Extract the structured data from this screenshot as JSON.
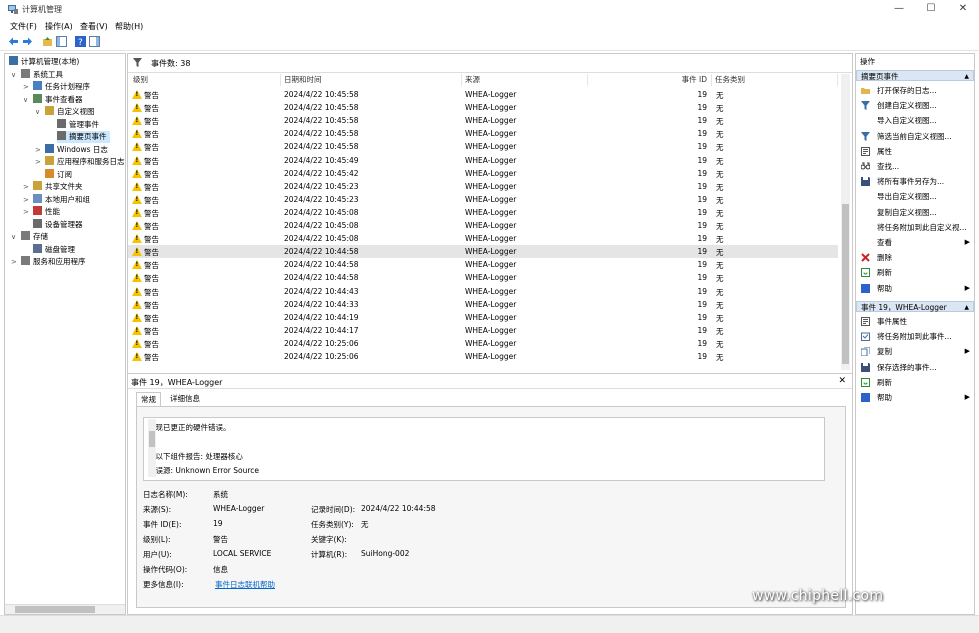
{
  "window": {
    "title": "计算机管理",
    "minimize": "—",
    "maximize": "☐",
    "close": "✕"
  },
  "menu": [
    "文件(F)",
    "操作(A)",
    "查看(V)",
    "帮助(H)"
  ],
  "tree": {
    "items": [
      {
        "label": "计算机管理(本地)",
        "indent": 0,
        "expander": ""
      },
      {
        "label": "系统工具",
        "indent": 1,
        "expander": "∨"
      },
      {
        "label": "任务计划程序",
        "indent": 2,
        "expander": ">"
      },
      {
        "label": "事件查看器",
        "indent": 2,
        "expander": "∨"
      },
      {
        "label": "自定义视图",
        "indent": 3,
        "expander": "∨"
      },
      {
        "label": "管理事件",
        "indent": 4,
        "expander": ""
      },
      {
        "label": "摘要页事件",
        "indent": 4,
        "expander": "",
        "selected": true
      },
      {
        "label": "Windows 日志",
        "indent": 3,
        "expander": ">"
      },
      {
        "label": "应用程序和服务日志",
        "indent": 3,
        "expander": ">"
      },
      {
        "label": "订阅",
        "indent": 3,
        "expander": ""
      },
      {
        "label": "共享文件夹",
        "indent": 2,
        "expander": ">"
      },
      {
        "label": "本地用户和组",
        "indent": 2,
        "expander": ">"
      },
      {
        "label": "性能",
        "indent": 2,
        "expander": ">"
      },
      {
        "label": "设备管理器",
        "indent": 2,
        "expander": ""
      },
      {
        "label": "存储",
        "indent": 1,
        "expander": "∨"
      },
      {
        "label": "磁盘管理",
        "indent": 2,
        "expander": ""
      },
      {
        "label": "服务和应用程序",
        "indent": 1,
        "expander": ">"
      }
    ]
  },
  "events": {
    "count_label": "事件数: 38",
    "columns": [
      "级别",
      "日期和时间",
      "来源",
      "事件 ID",
      "任务类别"
    ],
    "rows": [
      {
        "level": "警告",
        "datetime": "2024/4/22 10:45:58",
        "source": "WHEA-Logger",
        "id": "19",
        "task": "无"
      },
      {
        "level": "警告",
        "datetime": "2024/4/22 10:45:58",
        "source": "WHEA-Logger",
        "id": "19",
        "task": "无"
      },
      {
        "level": "警告",
        "datetime": "2024/4/22 10:45:58",
        "source": "WHEA-Logger",
        "id": "19",
        "task": "无"
      },
      {
        "level": "警告",
        "datetime": "2024/4/22 10:45:58",
        "source": "WHEA-Logger",
        "id": "19",
        "task": "无"
      },
      {
        "level": "警告",
        "datetime": "2024/4/22 10:45:58",
        "source": "WHEA-Logger",
        "id": "19",
        "task": "无"
      },
      {
        "level": "警告",
        "datetime": "2024/4/22 10:45:49",
        "source": "WHEA-Logger",
        "id": "19",
        "task": "无"
      },
      {
        "level": "警告",
        "datetime": "2024/4/22 10:45:42",
        "source": "WHEA-Logger",
        "id": "19",
        "task": "无"
      },
      {
        "level": "警告",
        "datetime": "2024/4/22 10:45:23",
        "source": "WHEA-Logger",
        "id": "19",
        "task": "无"
      },
      {
        "level": "警告",
        "datetime": "2024/4/22 10:45:23",
        "source": "WHEA-Logger",
        "id": "19",
        "task": "无"
      },
      {
        "level": "警告",
        "datetime": "2024/4/22 10:45:08",
        "source": "WHEA-Logger",
        "id": "19",
        "task": "无"
      },
      {
        "level": "警告",
        "datetime": "2024/4/22 10:45:08",
        "source": "WHEA-Logger",
        "id": "19",
        "task": "无"
      },
      {
        "level": "警告",
        "datetime": "2024/4/22 10:45:08",
        "source": "WHEA-Logger",
        "id": "19",
        "task": "无"
      },
      {
        "level": "警告",
        "datetime": "2024/4/22 10:44:58",
        "source": "WHEA-Logger",
        "id": "19",
        "task": "无",
        "selected": true
      },
      {
        "level": "警告",
        "datetime": "2024/4/22 10:44:58",
        "source": "WHEA-Logger",
        "id": "19",
        "task": "无"
      },
      {
        "level": "警告",
        "datetime": "2024/4/22 10:44:58",
        "source": "WHEA-Logger",
        "id": "19",
        "task": "无"
      },
      {
        "level": "警告",
        "datetime": "2024/4/22 10:44:43",
        "source": "WHEA-Logger",
        "id": "19",
        "task": "无"
      },
      {
        "level": "警告",
        "datetime": "2024/4/22 10:44:33",
        "source": "WHEA-Logger",
        "id": "19",
        "task": "无"
      },
      {
        "level": "警告",
        "datetime": "2024/4/22 10:44:19",
        "source": "WHEA-Logger",
        "id": "19",
        "task": "无"
      },
      {
        "level": "警告",
        "datetime": "2024/4/22 10:44:17",
        "source": "WHEA-Logger",
        "id": "19",
        "task": "无"
      },
      {
        "level": "警告",
        "datetime": "2024/4/22 10:25:06",
        "source": "WHEA-Logger",
        "id": "19",
        "task": "无"
      },
      {
        "level": "警告",
        "datetime": "2024/4/22 10:25:06",
        "source": "WHEA-Logger",
        "id": "19",
        "task": "无"
      }
    ]
  },
  "detail": {
    "title": "事件 19，WHEA-Logger",
    "close": "✕",
    "tabs": [
      "常规",
      "详细信息"
    ],
    "description": [
      "出现已更正的硬件错误。",
      "由以下组件报告: 处理器核心",
      "错误源: Unknown Error Source"
    ],
    "fields": {
      "log_name_label": "日志名称(M):",
      "log_name": "系统",
      "source_label": "来源(S):",
      "source": "WHEA-Logger",
      "logged_label": "记录时间(D):",
      "logged": "2024/4/22 10:44:58",
      "event_id_label": "事件 ID(E):",
      "event_id": "19",
      "task_label": "任务类别(Y):",
      "task": "无",
      "level_label": "级别(L):",
      "level": "警告",
      "keywords_label": "关键字(K):",
      "keywords": "",
      "user_label": "用户(U):",
      "user": "LOCAL SERVICE",
      "computer_label": "计算机(R):",
      "computer": "SuiHong-002",
      "opcode_label": "操作代码(O):",
      "opcode": "信息",
      "more_label": "更多信息(I):",
      "more_link": "事件日志联机帮助"
    }
  },
  "actions": {
    "header": "操作",
    "section1": "摘要页事件",
    "items1": [
      {
        "label": "打开保存的日志...",
        "icon": "folder-open-icon",
        "arrow": ""
      },
      {
        "label": "创建自定义视图...",
        "icon": "filter-icon",
        "arrow": ""
      },
      {
        "label": "导入自定义视图...",
        "icon": "none",
        "arrow": ""
      },
      {
        "label": "筛选当前自定义视图...",
        "icon": "filter-icon",
        "arrow": ""
      },
      {
        "label": "属性",
        "icon": "properties-icon",
        "arrow": ""
      },
      {
        "label": "查找...",
        "icon": "binoculars-icon",
        "arrow": ""
      },
      {
        "label": "将所有事件另存为...",
        "icon": "save-icon",
        "arrow": ""
      },
      {
        "label": "导出自定义视图...",
        "icon": "none",
        "arrow": ""
      },
      {
        "label": "复制自定义视图...",
        "icon": "none",
        "arrow": ""
      },
      {
        "label": "将任务附加到此自定义视...",
        "icon": "none",
        "arrow": ""
      },
      {
        "label": "查看",
        "icon": "none",
        "arrow": "▶"
      },
      {
        "label": "删除",
        "icon": "delete-icon",
        "arrow": ""
      },
      {
        "label": "刷新",
        "icon": "refresh-icon",
        "arrow": ""
      },
      {
        "label": "帮助",
        "icon": "help-icon",
        "arrow": "▶"
      }
    ],
    "section2": "事件 19，WHEA-Logger",
    "items2": [
      {
        "label": "事件属性",
        "icon": "properties-icon",
        "arrow": ""
      },
      {
        "label": "将任务附加到此事件...",
        "icon": "task-icon",
        "arrow": ""
      },
      {
        "label": "复制",
        "icon": "copy-icon",
        "arrow": "▶"
      },
      {
        "label": "保存选择的事件...",
        "icon": "save-icon",
        "arrow": ""
      },
      {
        "label": "刷新",
        "icon": "refresh-icon",
        "arrow": ""
      },
      {
        "label": "帮助",
        "icon": "help-icon",
        "arrow": "▶"
      }
    ]
  },
  "watermark": {
    "site": "www.chiphell.com"
  },
  "colors": {
    "accent": "#0078d7",
    "warning": "#f5c400",
    "selection": "#cce8ff",
    "section": "#dbe6f4"
  }
}
